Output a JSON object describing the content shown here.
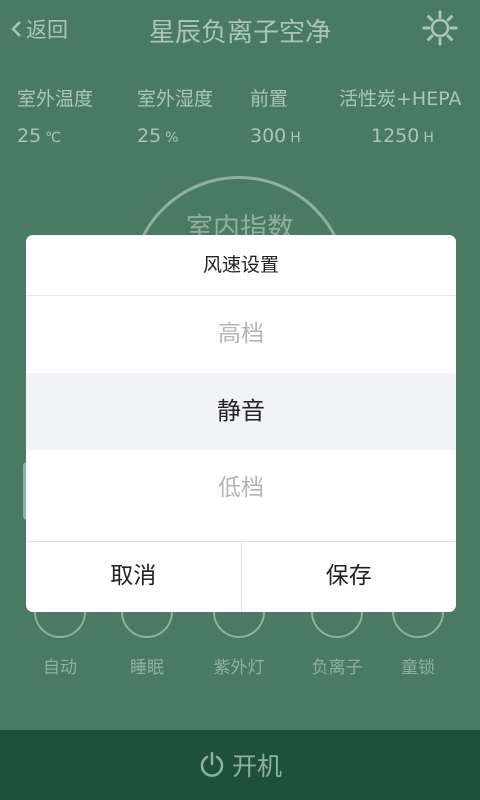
{
  "header": {
    "back_label": "返回",
    "title": "星辰负离子空净"
  },
  "stats": [
    {
      "label": "室外温度",
      "value": "25",
      "unit": "℃"
    },
    {
      "label": "室外湿度",
      "value": "25",
      "unit": "%"
    },
    {
      "label": "前置",
      "value": "300",
      "unit": "H"
    },
    {
      "label": "活性炭+HEPA",
      "value": "1250",
      "unit": "H"
    }
  ],
  "dial": {
    "label": "室内指数"
  },
  "modes": [
    {
      "label": "自动"
    },
    {
      "label": "睡眠"
    },
    {
      "label": "紫外灯"
    },
    {
      "label": "负离子"
    },
    {
      "label": "童锁"
    }
  ],
  "bottom": {
    "power_label": "开机"
  },
  "dialog": {
    "title": "风速设置",
    "options": [
      "高档",
      "静音",
      "低档"
    ],
    "selected": "静音",
    "cancel_label": "取消",
    "save_label": "保存"
  },
  "colors": {
    "background": "#4a7a63",
    "bottom_bar": "#1d5238",
    "muted_text": "#a9c7b8"
  }
}
